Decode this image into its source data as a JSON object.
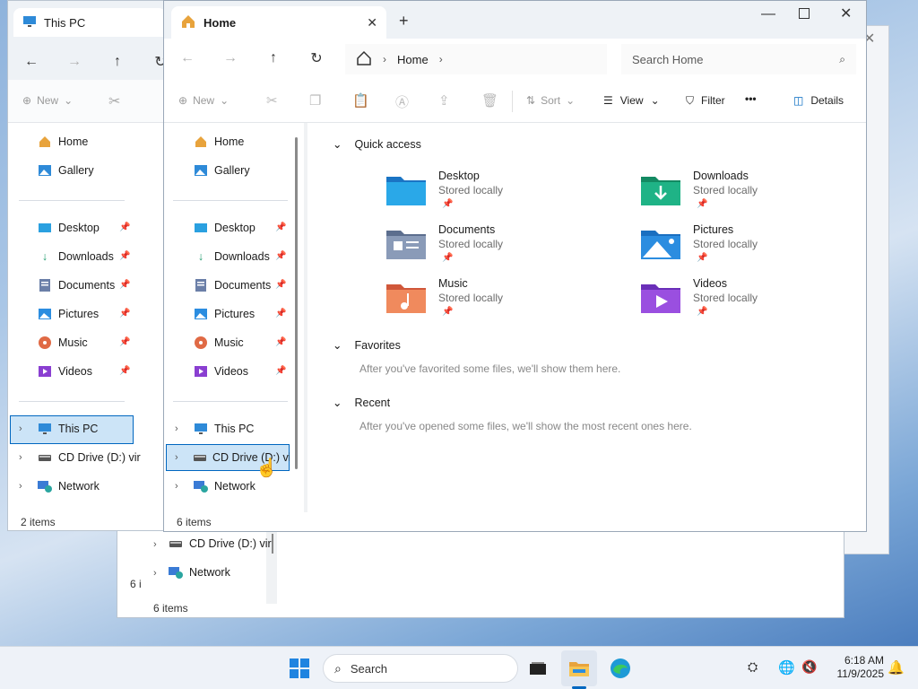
{
  "back_win": {
    "tab_title": "This PC",
    "new_label": "New",
    "sidebar": [
      "Home",
      "Gallery",
      "Desktop",
      "Downloads",
      "Documents",
      "Pictures",
      "Music",
      "Videos",
      "This PC",
      "CD Drive (D:) vir",
      "Network"
    ],
    "status": "2 items"
  },
  "mid_win": {
    "sidebar_bottom": [
      "CD Drive (D:) vir",
      "Network"
    ],
    "status": "6 items",
    "status2": "6 i"
  },
  "front_win": {
    "tab_title": "Home",
    "address": "Home",
    "search_placeholder": "Search Home",
    "toolbar": {
      "new": "New",
      "sort": "Sort",
      "view": "View",
      "filter": "Filter",
      "more": "•••",
      "details": "Details"
    },
    "sidebar": {
      "home": "Home",
      "gallery": "Gallery",
      "desktop": "Desktop",
      "downloads": "Downloads",
      "documents": "Documents",
      "pictures": "Pictures",
      "music": "Music",
      "videos": "Videos",
      "this_pc": "This PC",
      "cd_drive": "CD Drive (D:) vir",
      "network": "Network"
    },
    "quick_access_title": "Quick access",
    "quick_access": [
      {
        "name": "Desktop",
        "sub": "Stored locally"
      },
      {
        "name": "Downloads",
        "sub": "Stored locally"
      },
      {
        "name": "Documents",
        "sub": "Stored locally"
      },
      {
        "name": "Pictures",
        "sub": "Stored locally"
      },
      {
        "name": "Music",
        "sub": "Stored locally"
      },
      {
        "name": "Videos",
        "sub": "Stored locally"
      }
    ],
    "favorites_title": "Favorites",
    "favorites_empty": "After you've favorited some files, we'll show them here.",
    "recent_title": "Recent",
    "recent_empty": "After you've opened some files, we'll show the most recent ones here.",
    "status": "6 items"
  },
  "taskbar": {
    "search_label": "Search",
    "time": "6:18 AM",
    "date": "11/9/2025"
  },
  "colors": {
    "accent": "#0067c0",
    "selection": "#cce4f7",
    "folder_blue": "#2b8de0"
  }
}
